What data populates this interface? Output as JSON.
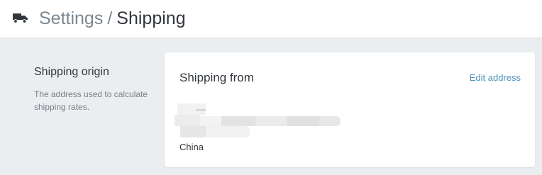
{
  "header": {
    "icon": "truck-icon",
    "breadcrumb_parent": "Settings",
    "breadcrumb_separator": "/",
    "breadcrumb_current": "Shipping"
  },
  "section": {
    "title": "Shipping origin",
    "description": "The address used to calculate shipping rates."
  },
  "card": {
    "title": "Shipping from",
    "edit_label": "Edit address",
    "country": "China"
  },
  "colors": {
    "link": "#4e92bb",
    "page_background": "#ebeef0",
    "card_background": "#ffffff"
  }
}
